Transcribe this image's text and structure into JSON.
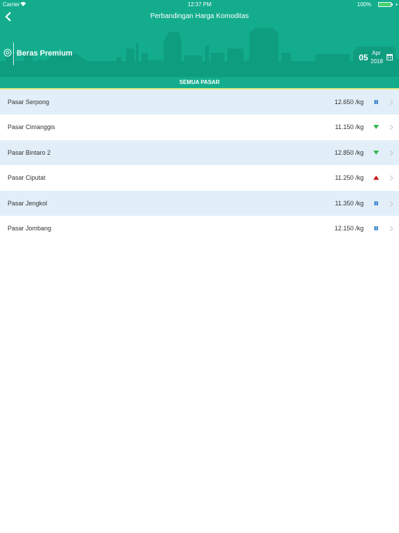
{
  "status_bar": {
    "carrier": "Carrier",
    "time": "12:37 PM",
    "battery": "100%"
  },
  "nav": {
    "title": "Perbandingan Harga Komoditas"
  },
  "commodity": {
    "name": "Beras Premium"
  },
  "date": {
    "day": "05",
    "month": "Apr",
    "year": "2018"
  },
  "tab": {
    "label": "SEMUA PASAR"
  },
  "markets": [
    {
      "name": "Pasar Serpong",
      "price": "12.650 /kg",
      "trend": "stable"
    },
    {
      "name": "Pasar Cimanggis",
      "price": "11.150 /kg",
      "trend": "down"
    },
    {
      "name": "Pasar Bintaro 2",
      "price": "12.850 /kg",
      "trend": "down"
    },
    {
      "name": "Pasar Ciputat",
      "price": "11.250 /kg",
      "trend": "up"
    },
    {
      "name": "Pasar Jengkol",
      "price": "11.350 /kg",
      "trend": "stable"
    },
    {
      "name": "Pasar Jombang",
      "price": "12.150 /kg",
      "trend": "stable"
    }
  ],
  "colors": {
    "header": "#13ad8e",
    "skyline": "#0f9d80",
    "row_shade": "#e2eff8",
    "down": "#2db84d",
    "up": "#cc1111",
    "stable": "#1e73c8"
  }
}
